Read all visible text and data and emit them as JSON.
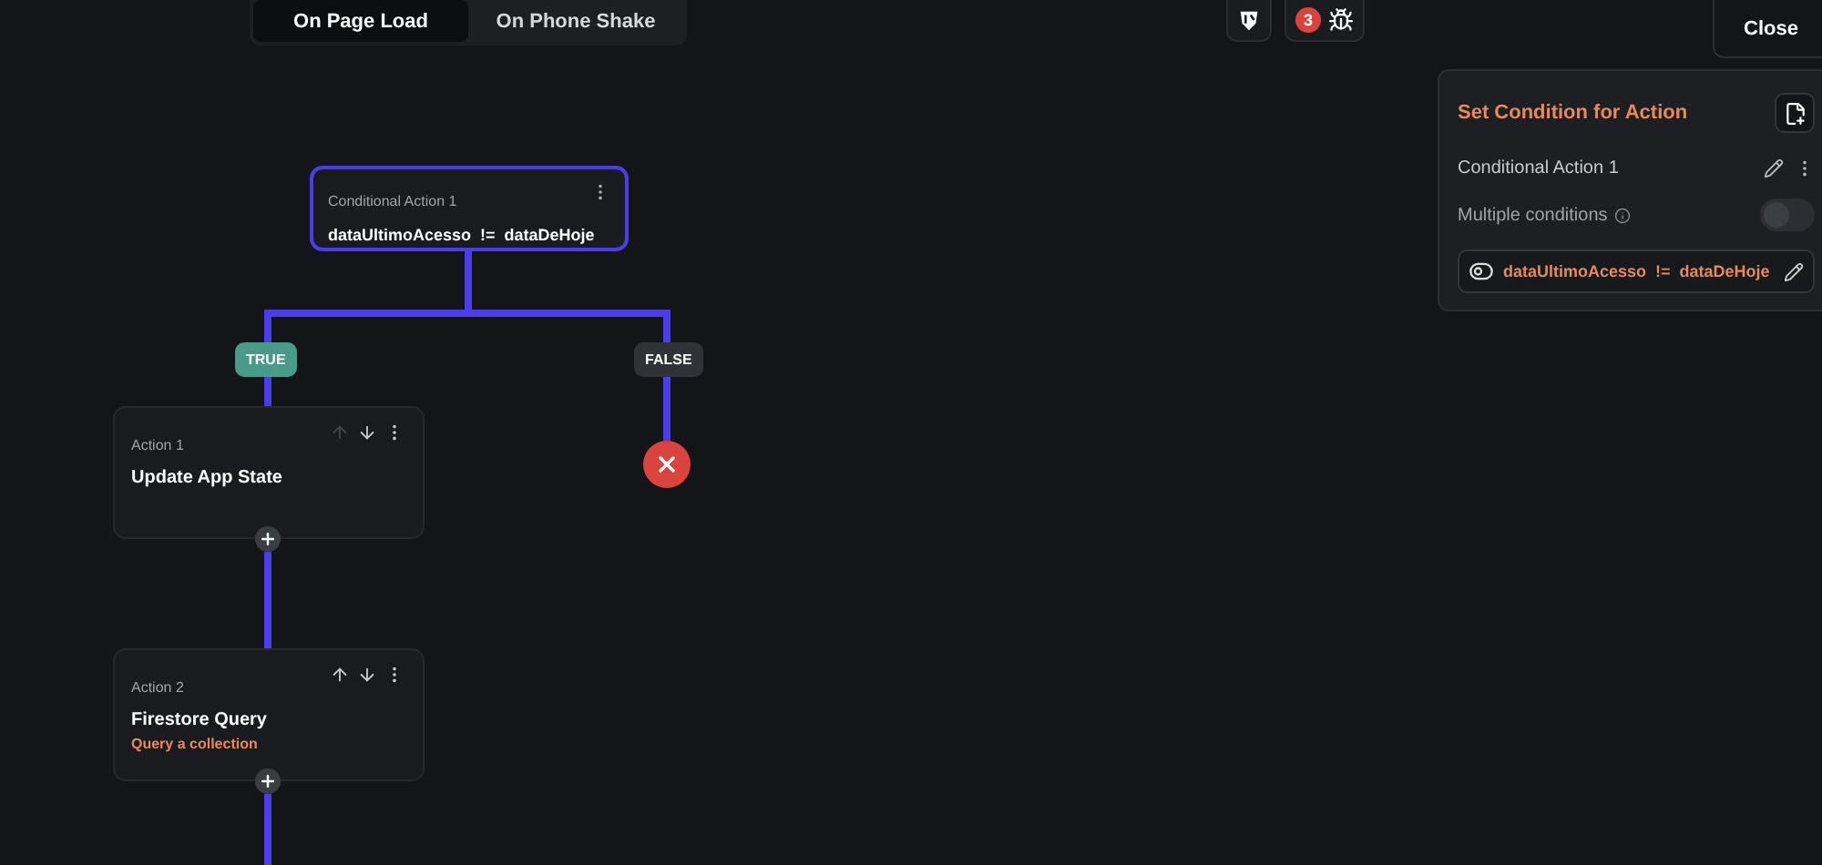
{
  "trigger_tabs": [
    {
      "label": "On Page Load",
      "selected": true
    },
    {
      "label": "On Phone Shake",
      "selected": false
    }
  ],
  "toolbar": {
    "error_count": "3"
  },
  "close_button": "Close",
  "panel": {
    "title": "Set Condition for Action",
    "action_name": "Conditional Action 1",
    "multiple_conditions": {
      "label": "Multiple conditions",
      "on": false
    },
    "condition": {
      "left": "dataUltimoAcesso",
      "operator": "!=",
      "right": "dataDeHoje"
    }
  },
  "canvas": {
    "conditional": {
      "title": "Conditional Action 1",
      "left": "dataUltimoAcesso",
      "operator": "!=",
      "right": "dataDeHoje"
    },
    "branches": [
      {
        "label": "TRUE",
        "kind": "true"
      },
      {
        "label": "FALSE",
        "kind": "false"
      }
    ],
    "actions": [
      {
        "label": "Action 1",
        "title": "Update App State",
        "can_move_up": false
      },
      {
        "label": "Action 2",
        "title": "Firestore Query",
        "subtitle": "Query a collection",
        "can_move_up": true
      }
    ]
  }
}
